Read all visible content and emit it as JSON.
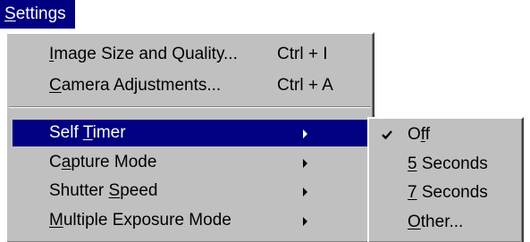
{
  "menubar": {
    "settings_pre": "",
    "settings_key": "S",
    "settings_post": "ettings"
  },
  "menu": {
    "image_size": {
      "pre": "",
      "key": "I",
      "post": "mage Size and Quality...",
      "shortcut": "Ctrl + I"
    },
    "camera_adj": {
      "pre": "",
      "key": "C",
      "post": "amera Adjustments...",
      "shortcut": "Ctrl + A"
    },
    "self_timer": {
      "pre": "Self ",
      "key": "T",
      "post": "imer"
    },
    "capture_mode": {
      "pre": "C",
      "key": "a",
      "post": "pture Mode"
    },
    "shutter_speed": {
      "pre": "Shutter ",
      "key": "S",
      "post": "peed"
    },
    "multiple_exposure": {
      "pre": "",
      "key": "M",
      "post": "ultiple Exposure Mode"
    }
  },
  "submenu": {
    "off": {
      "pre": "O",
      "key": "f",
      "post": "f",
      "checked": true
    },
    "five_seconds": {
      "pre": "",
      "key": "5",
      "post": " Seconds"
    },
    "seven_seconds": {
      "pre": "",
      "key": "7",
      "post": " Seconds"
    },
    "other": {
      "pre": "",
      "key": "O",
      "post": "ther..."
    }
  },
  "colors": {
    "menu_bg": "#c0c0c0",
    "highlight": "#000080",
    "highlight_text": "#ffffff"
  },
  "icons": {
    "submenu_arrow": "triangle-right-icon",
    "check": "check-icon"
  }
}
